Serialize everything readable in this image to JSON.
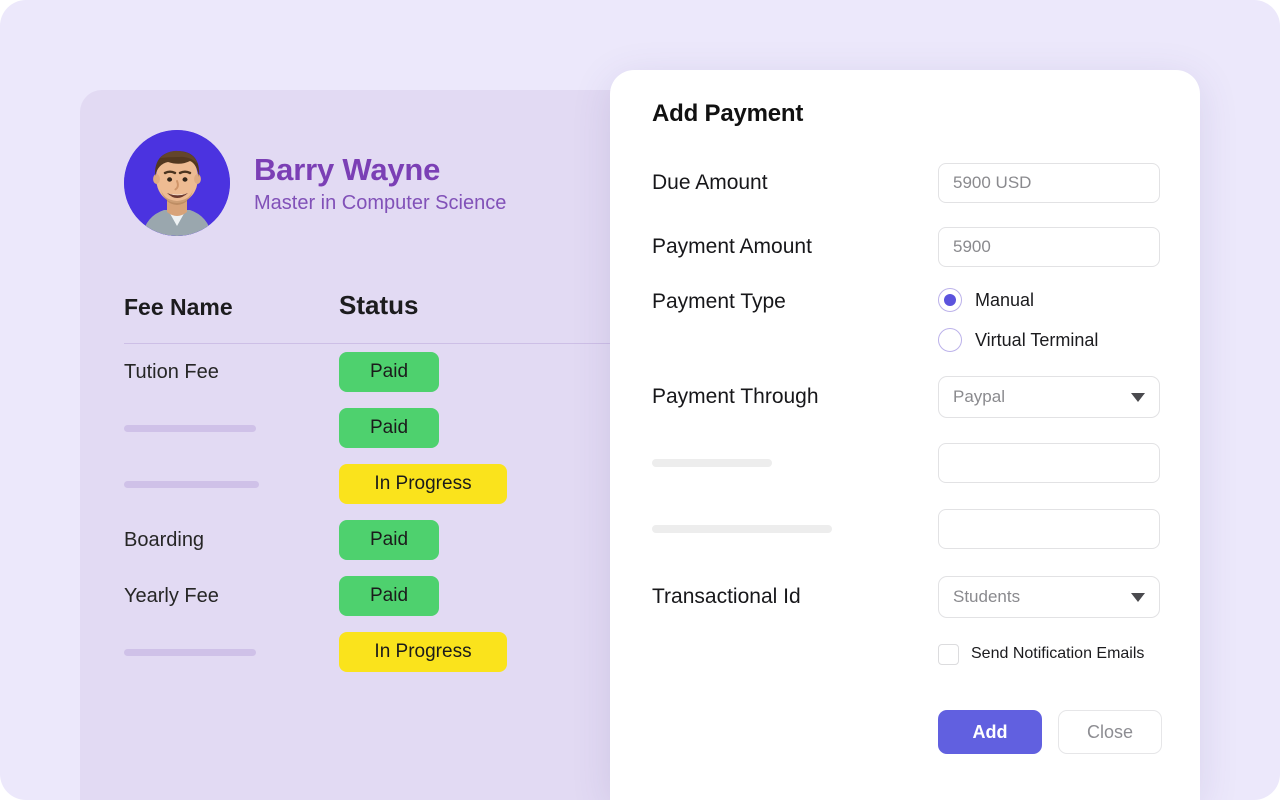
{
  "student": {
    "name": "Barry Wayne",
    "program": "Master in Computer Science",
    "avatar_alt": "student-photo"
  },
  "fee_table": {
    "columns": {
      "name": "Fee Name",
      "status": "Status"
    },
    "rows": [
      {
        "name": "Tution Fee",
        "name_is_skeleton": false,
        "status": "Paid",
        "status_kind": "paid"
      },
      {
        "name": "",
        "name_is_skeleton": true,
        "status": "Paid",
        "status_kind": "paid"
      },
      {
        "name": "",
        "name_is_skeleton": true,
        "status": "In Progress",
        "status_kind": "progress"
      },
      {
        "name": "Boarding",
        "name_is_skeleton": false,
        "status": "Paid",
        "status_kind": "paid"
      },
      {
        "name": "Yearly Fee",
        "name_is_skeleton": false,
        "status": "Paid",
        "status_kind": "paid"
      },
      {
        "name": "",
        "name_is_skeleton": true,
        "status": "In Progress",
        "status_kind": "progress"
      }
    ]
  },
  "modal": {
    "title": "Add Payment",
    "fields": {
      "due_amount_label": "Due Amount",
      "due_amount_value": "5900 USD",
      "payment_amount_label": "Payment Amount",
      "payment_amount_value": "5900",
      "payment_type_label": "Payment Type",
      "payment_type_options": [
        {
          "label": "Manual",
          "selected": true
        },
        {
          "label": "Virtual Terminal",
          "selected": false
        }
      ],
      "payment_through_label": "Payment Through",
      "payment_through_value": "Paypal",
      "transactional_id_label": "Transactional Id",
      "transactional_id_value": "Students"
    },
    "checkbox": {
      "label": "Send Notification Emails",
      "checked": false
    },
    "buttons": {
      "primary": "Add",
      "secondary": "Close"
    }
  },
  "colors": {
    "page_background": "#ece8fb",
    "card_background": "#e2daf3",
    "accent_purple": "#7b3fb5",
    "avatar_background": "#4b33e0",
    "status_paid": "#4ed16e",
    "status_progress": "#fae31c",
    "primary_button": "#6160e0",
    "radio_selected": "#5b53dd"
  }
}
